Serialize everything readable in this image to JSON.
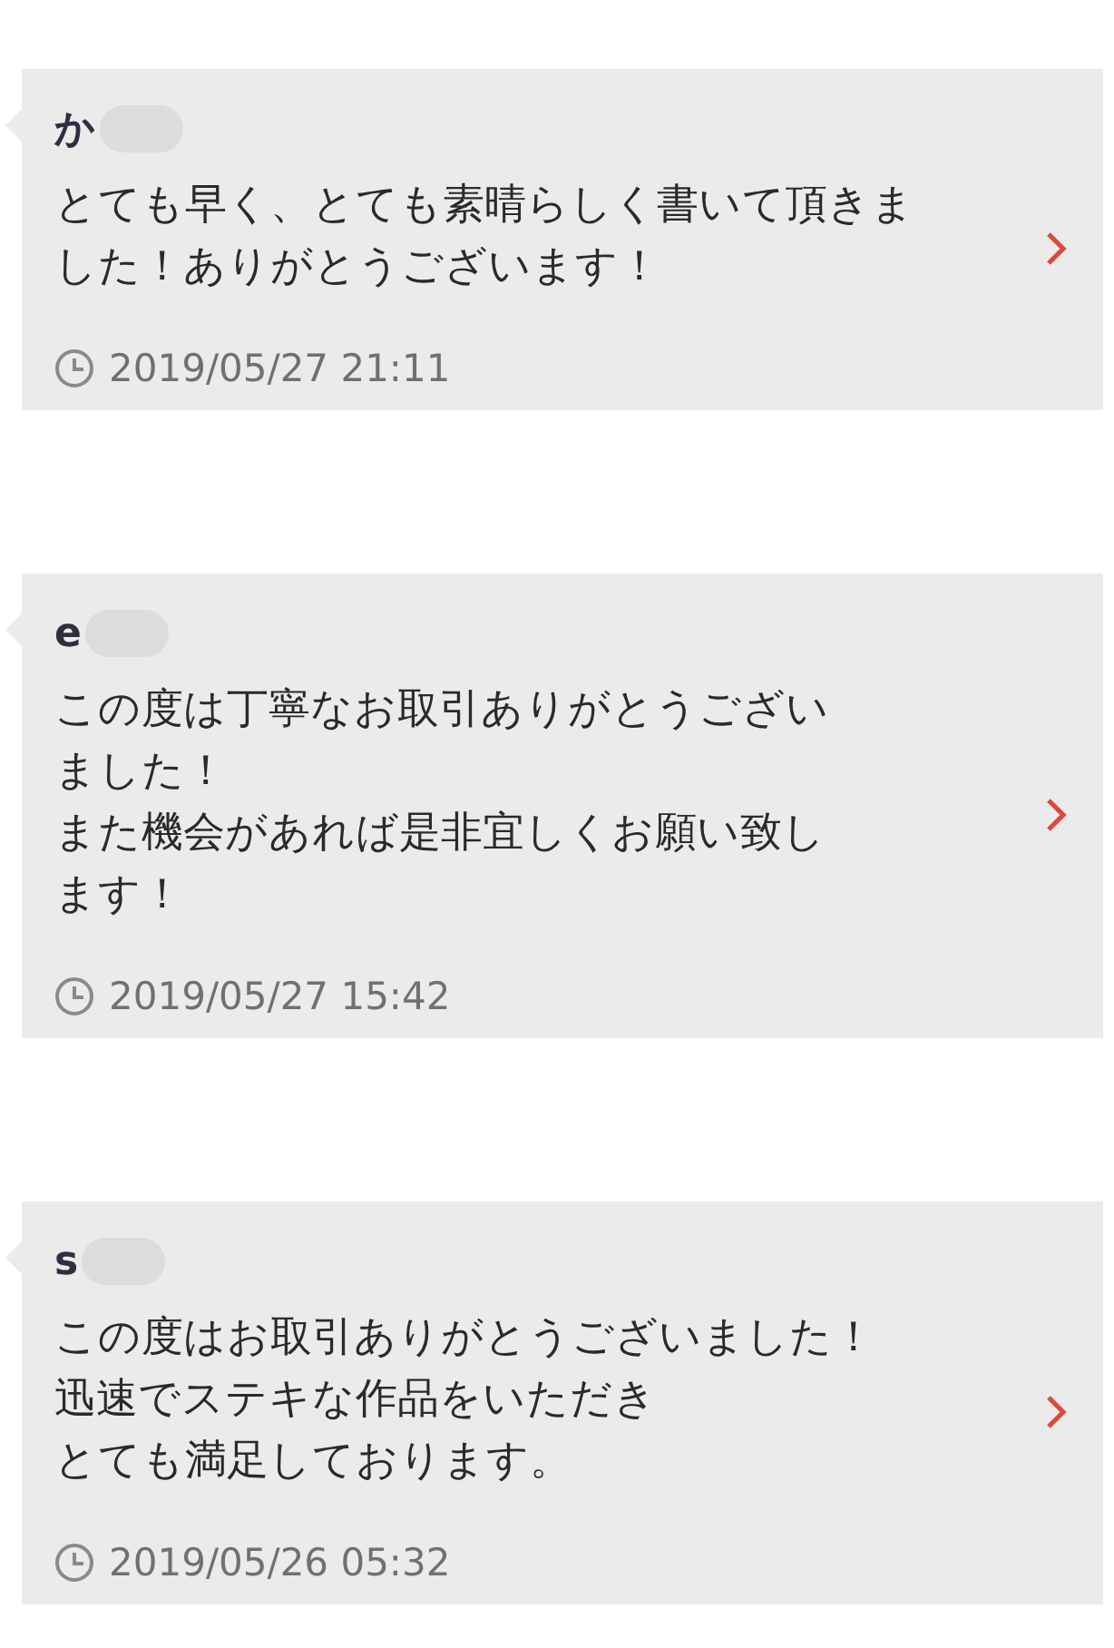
{
  "reviews": [
    {
      "initial": "か",
      "lines": [
        "とても早く、とても素晴らしく書いて頂きま",
        "した！ありがとうございます！"
      ],
      "date": "2019/05/27 21:11"
    },
    {
      "initial": "e",
      "lines": [
        "この度は丁寧なお取引ありがとうござい",
        "ました！",
        "また機会があれば是非宜しくお願い致し",
        "ます！"
      ],
      "date": "2019/05/27 15:42"
    },
    {
      "initial": "s",
      "lines": [
        "この度はお取引ありがとうございました！",
        "迅速でステキな作品をいただき",
        "とても満足しております。"
      ],
      "date": "2019/05/26 05:32"
    }
  ]
}
